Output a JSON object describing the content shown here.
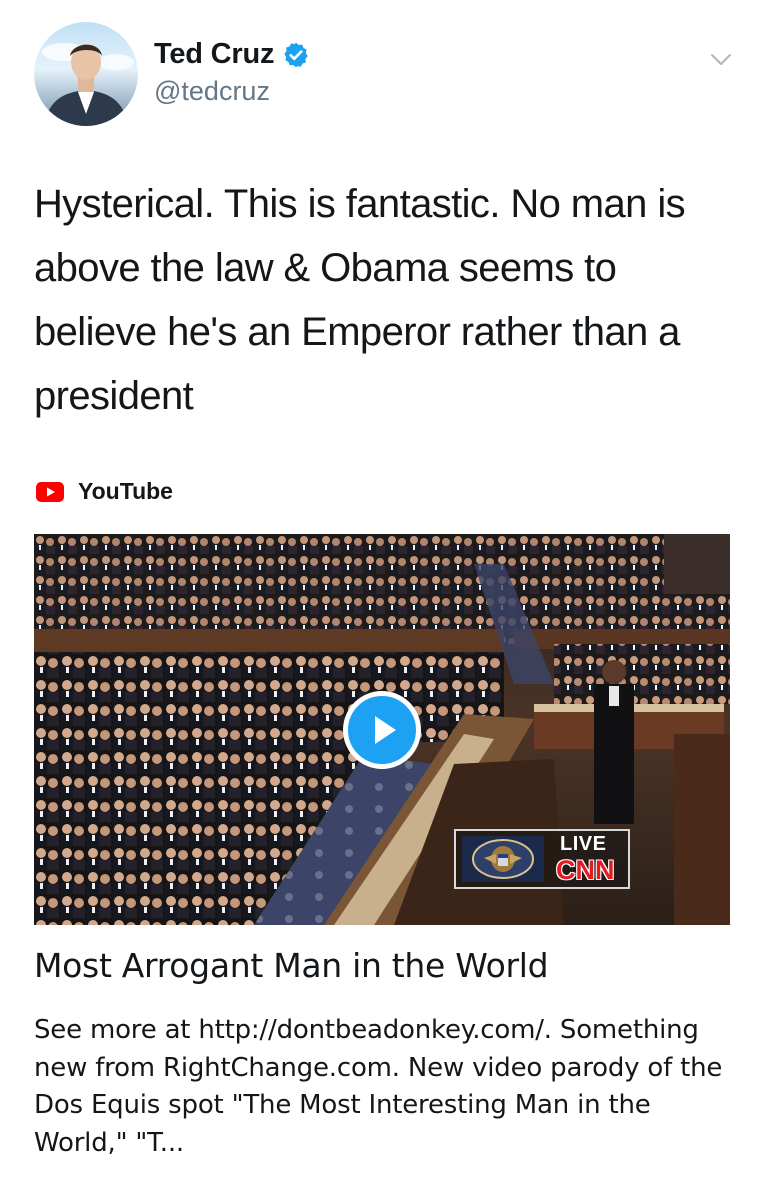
{
  "author": {
    "display_name": "Ted Cruz",
    "handle": "@tedcruz",
    "verified": true
  },
  "tweet": {
    "text": "Hysterical. This is fantastic. No man is above the law & Obama seems to believe he's an Emperor rather than a president"
  },
  "card": {
    "source": "YouTube",
    "overlay_live": "LIVE",
    "overlay_network": "CNN",
    "title": "Most Arrogant Man in the World",
    "description": "See more at http://dontbeadonkey.com/. Something new from RightChange.com. New video parody of the Dos Equis spot \"The Most Interesting Man in the World,\" \"T..."
  },
  "colors": {
    "accent": "#1da1f2",
    "youtube_red": "#ff0000",
    "secondary_text": "#657786",
    "cnn_red": "#e31b23"
  },
  "icons": [
    "verified-badge-icon",
    "chevron-down-icon",
    "youtube-icon",
    "play-icon"
  ]
}
